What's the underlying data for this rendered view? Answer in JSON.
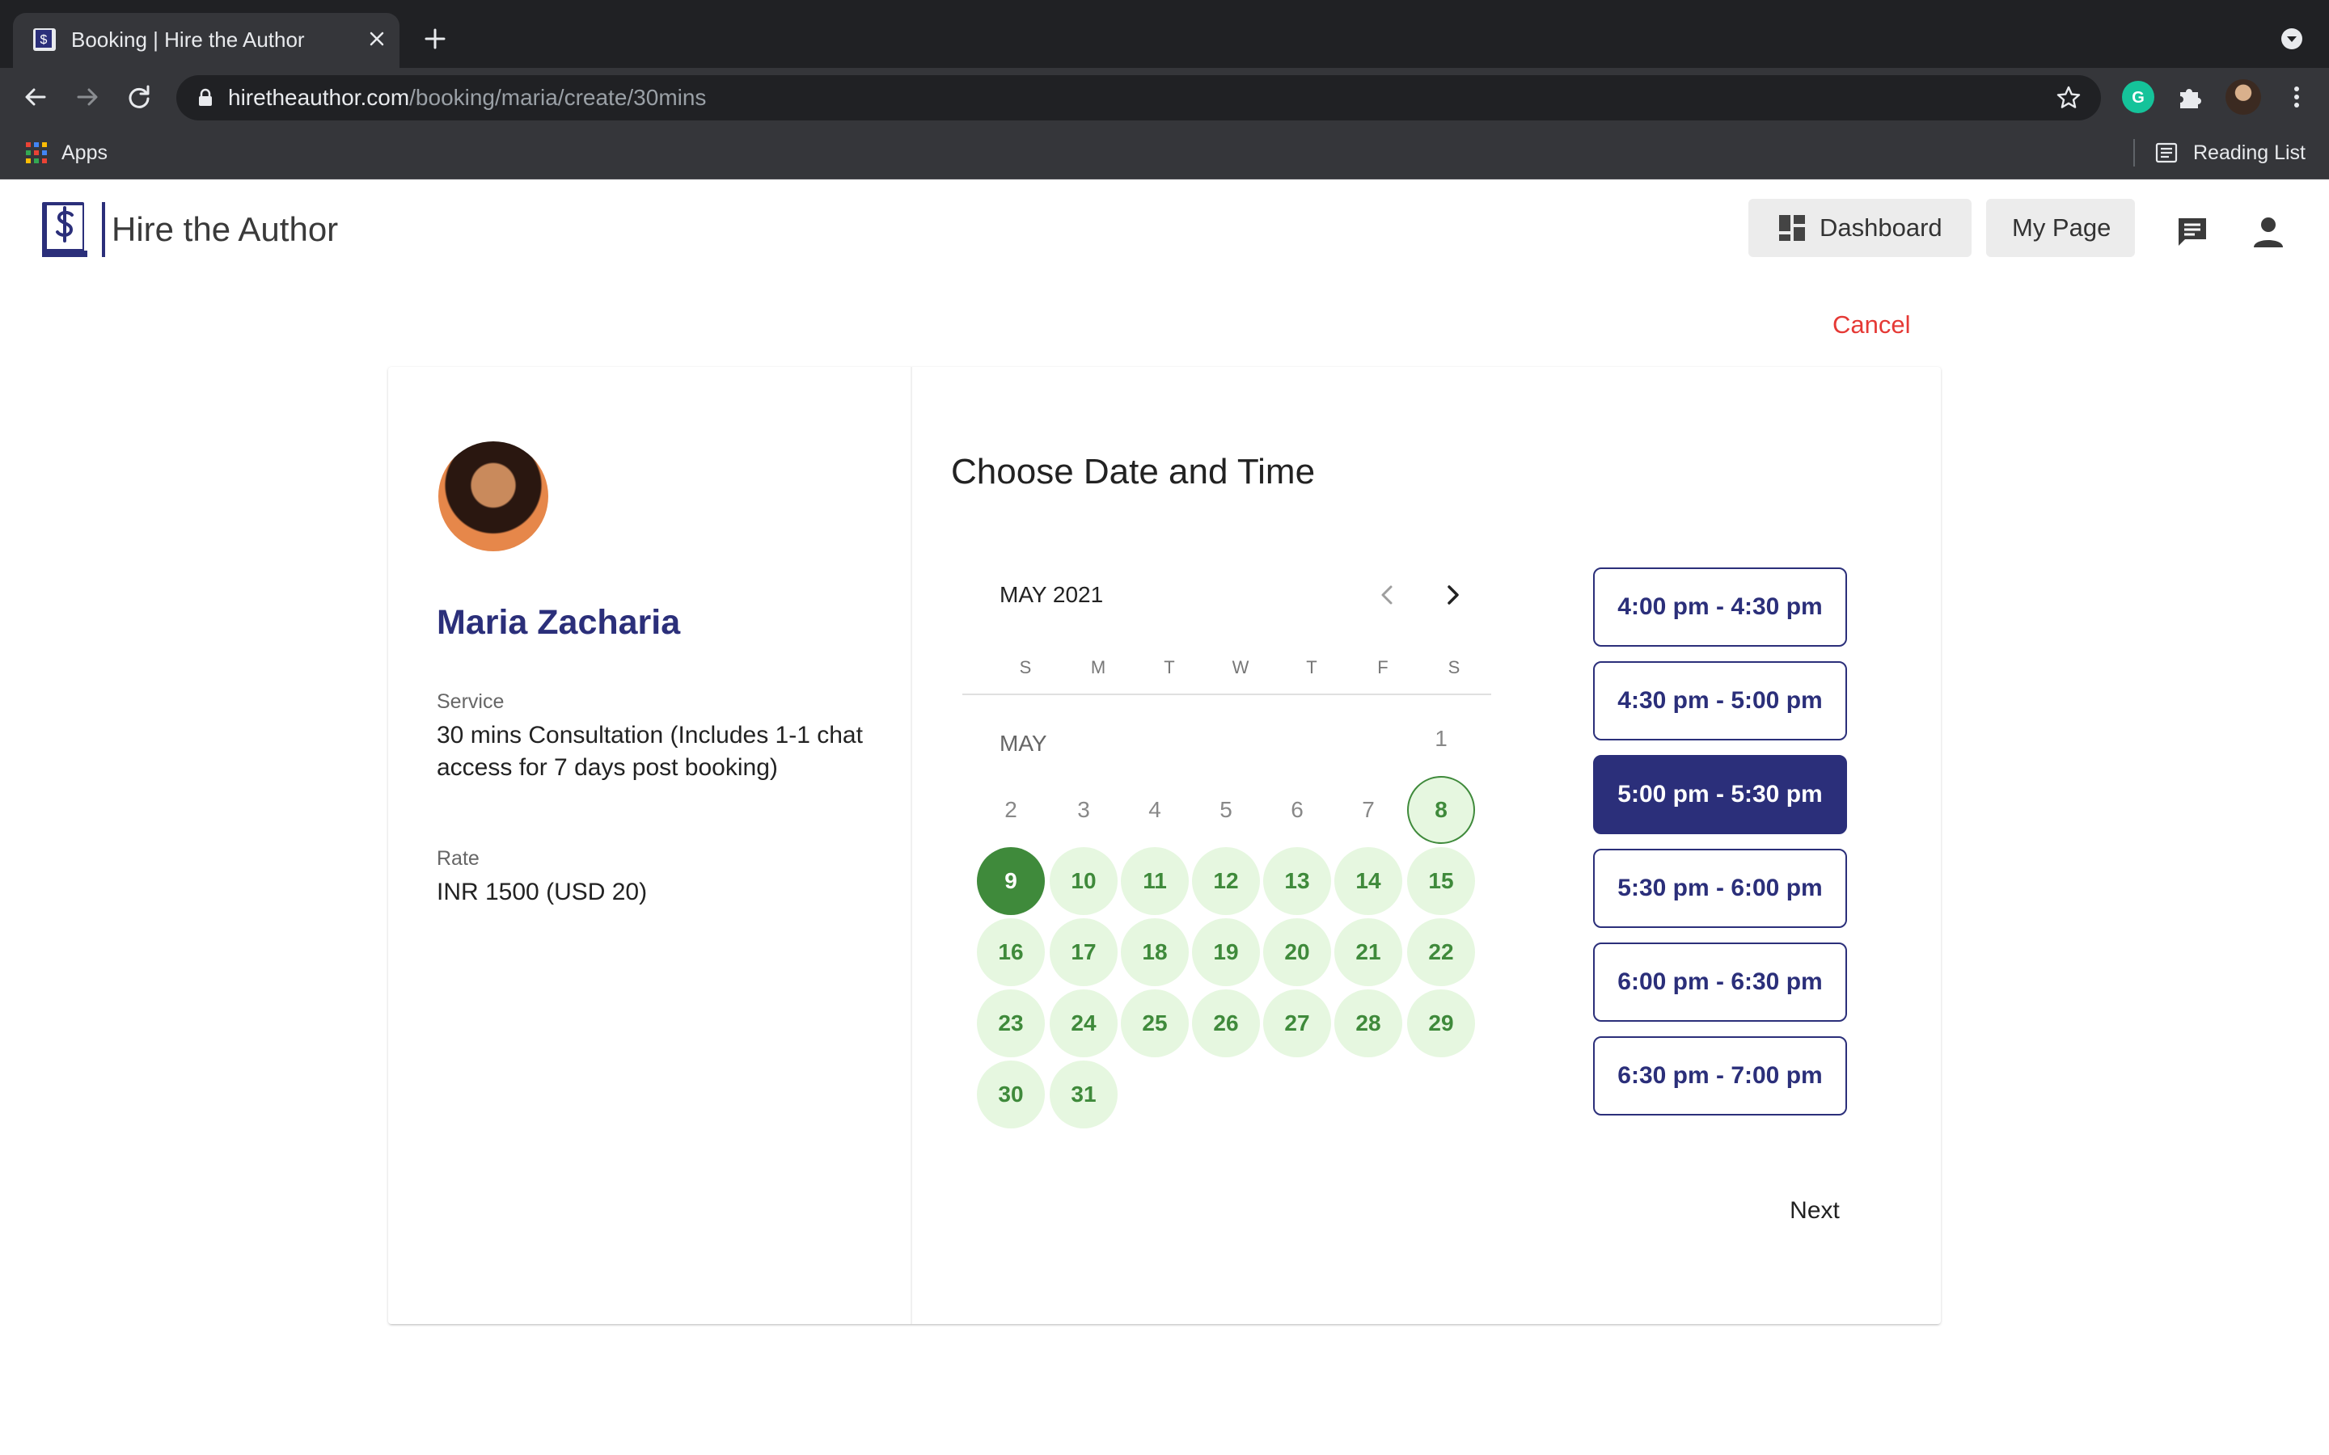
{
  "browser": {
    "tab_title": "Booking | Hire the Author",
    "url_host": "hiretheauthor.com",
    "url_path": "/booking/maria/create/30mins",
    "bookmarks": {
      "apps_label": "Apps",
      "reading_list_label": "Reading List"
    },
    "icons": [
      "favicon-icon",
      "close-icon",
      "plus-icon",
      "back-icon",
      "forward-icon",
      "reload-icon",
      "lock-icon",
      "star-icon",
      "grammarly-icon",
      "puzzle-icon",
      "profile-avatar",
      "more-icon",
      "apps-grid-icon",
      "reading-list-icon"
    ]
  },
  "header": {
    "brand": "Hire the Author",
    "nav": {
      "dashboard_label": "Dashboard",
      "my_page_label": "My Page"
    },
    "icons": [
      "chat-icon",
      "user-icon"
    ]
  },
  "cancel_label": "Cancel",
  "author": {
    "name": "Maria Zacharia",
    "service_label": "Service",
    "service_value": "30 mins Consultation (Includes 1-1 chat access for 7 days post booking)",
    "rate_label": "Rate",
    "rate_value": "INR 1500 (USD 20)"
  },
  "booking": {
    "title": "Choose Date and Time",
    "month_label": "MAY 2021",
    "weekdays": [
      "S",
      "M",
      "T",
      "W",
      "T",
      "F",
      "S"
    ],
    "month_row_label": "MAY",
    "days": [
      {
        "label": "1",
        "state": "plain"
      },
      {
        "label": "2",
        "state": "plain"
      },
      {
        "label": "3",
        "state": "plain"
      },
      {
        "label": "4",
        "state": "plain"
      },
      {
        "label": "5",
        "state": "plain"
      },
      {
        "label": "6",
        "state": "plain"
      },
      {
        "label": "7",
        "state": "plain"
      },
      {
        "label": "8",
        "state": "today"
      },
      {
        "label": "9",
        "state": "selected"
      },
      {
        "label": "10",
        "state": "avail"
      },
      {
        "label": "11",
        "state": "avail"
      },
      {
        "label": "12",
        "state": "avail"
      },
      {
        "label": "13",
        "state": "avail"
      },
      {
        "label": "14",
        "state": "avail"
      },
      {
        "label": "15",
        "state": "avail"
      },
      {
        "label": "16",
        "state": "avail"
      },
      {
        "label": "17",
        "state": "avail"
      },
      {
        "label": "18",
        "state": "avail"
      },
      {
        "label": "19",
        "state": "avail"
      },
      {
        "label": "20",
        "state": "avail"
      },
      {
        "label": "21",
        "state": "avail"
      },
      {
        "label": "22",
        "state": "avail"
      },
      {
        "label": "23",
        "state": "avail"
      },
      {
        "label": "24",
        "state": "avail"
      },
      {
        "label": "25",
        "state": "avail"
      },
      {
        "label": "26",
        "state": "avail"
      },
      {
        "label": "27",
        "state": "avail"
      },
      {
        "label": "28",
        "state": "avail"
      },
      {
        "label": "29",
        "state": "avail"
      },
      {
        "label": "30",
        "state": "avail"
      },
      {
        "label": "31",
        "state": "avail"
      }
    ],
    "time_slots": [
      {
        "label": "4:00 pm - 4:30 pm",
        "selected": false
      },
      {
        "label": "4:30 pm - 5:00 pm",
        "selected": false
      },
      {
        "label": "5:00 pm - 5:30 pm",
        "selected": true
      },
      {
        "label": "5:30 pm - 6:00 pm",
        "selected": false
      },
      {
        "label": "6:00 pm - 6:30 pm",
        "selected": false
      },
      {
        "label": "6:30 pm - 7:00 pm",
        "selected": false
      }
    ],
    "next_label": "Next"
  },
  "colors": {
    "brand_navy": "#2b2f7a",
    "available_green": "#3f8a3b",
    "available_bg": "#e6f7e0",
    "cancel_red": "#e53935"
  }
}
